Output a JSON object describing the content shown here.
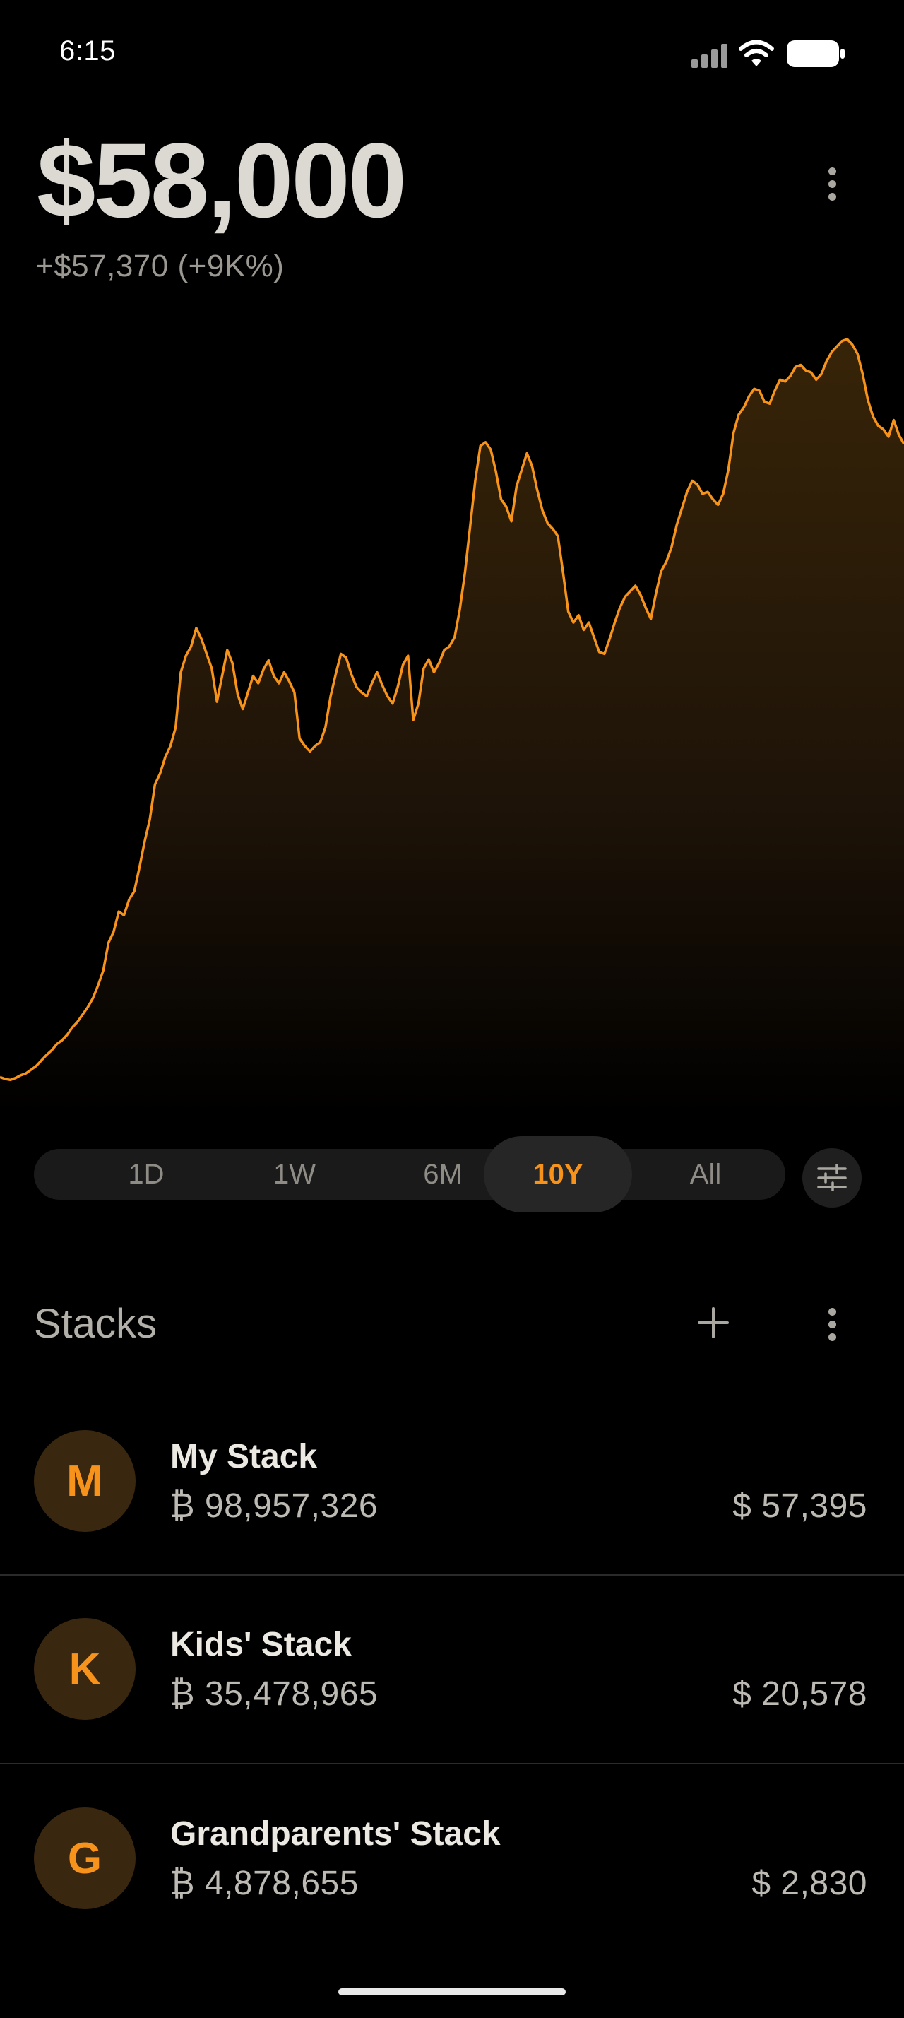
{
  "status_bar": {
    "time": "6:15"
  },
  "header": {
    "balance": "$58,000",
    "change": "+$57,370 (+9K%)"
  },
  "chart_data": {
    "type": "area",
    "title": "",
    "xlabel": "",
    "ylabel": "",
    "line_color": "#f7931a",
    "series": [
      {
        "values": [
          12,
          10,
          9,
          11,
          14,
          16,
          20,
          24,
          30,
          36,
          41,
          48,
          52,
          58,
          66,
          72,
          80,
          88,
          98,
          112,
          128,
          158,
          170,
          192,
          188,
          205,
          214,
          240,
          268,
          292,
          330,
          342,
          360,
          372,
          392,
          452,
          470,
          480,
          500,
          488,
          472,
          456,
          420,
          448,
          476,
          462,
          428,
          412,
          430,
          448,
          440,
          455,
          465,
          448,
          440,
          452,
          442,
          430,
          380,
          372,
          366,
          372,
          376,
          392,
          426,
          450,
          472,
          468,
          450,
          436,
          430,
          426,
          440,
          452,
          438,
          426,
          418,
          436,
          460,
          470,
          400,
          418,
          456,
          466,
          452,
          462,
          476,
          480,
          490,
          520,
          560,
          610,
          660,
          698,
          702,
          694,
          670,
          640,
          632,
          616,
          654,
          672,
          690,
          676,
          650,
          628,
          614,
          608,
          600,
          560,
          518,
          506,
          514,
          498,
          506,
          490,
          474,
          472,
          488,
          506,
          522,
          534,
          540,
          546,
          536,
          522,
          510,
          538,
          562,
          572,
          588,
          612,
          630,
          648,
          660,
          656,
          646,
          648,
          640,
          634,
          646,
          672,
          712,
          732,
          740,
          752,
          760,
          758,
          746,
          744,
          758,
          770,
          768,
          774,
          784,
          786,
          780,
          778,
          770,
          776,
          790,
          800,
          806,
          812,
          814,
          808,
          798,
          776,
          748,
          730,
          720,
          716,
          708,
          726,
          710,
          700
        ]
      }
    ]
  },
  "range_selector": {
    "options": [
      "1D",
      "1W",
      "6M",
      "10Y",
      "All"
    ],
    "selected": "10Y",
    "filter_icon": "sliders-icon"
  },
  "stacks": {
    "title": "Stacks",
    "add_icon": "plus-icon",
    "menu_icon": "kebab-icon",
    "items": [
      {
        "initial": "M",
        "name": "My Stack",
        "btc": "₿ 98,957,326",
        "usd": "$ 57,395"
      },
      {
        "initial": "K",
        "name": "Kids' Stack",
        "btc": "₿ 35,478,965",
        "usd": "$ 20,578"
      },
      {
        "initial": "G",
        "name": "Grandparents' Stack",
        "btc": "₿ 4,878,655",
        "usd": "$ 2,830"
      }
    ]
  },
  "colors": {
    "accent": "#f7931a",
    "background": "#000000"
  }
}
